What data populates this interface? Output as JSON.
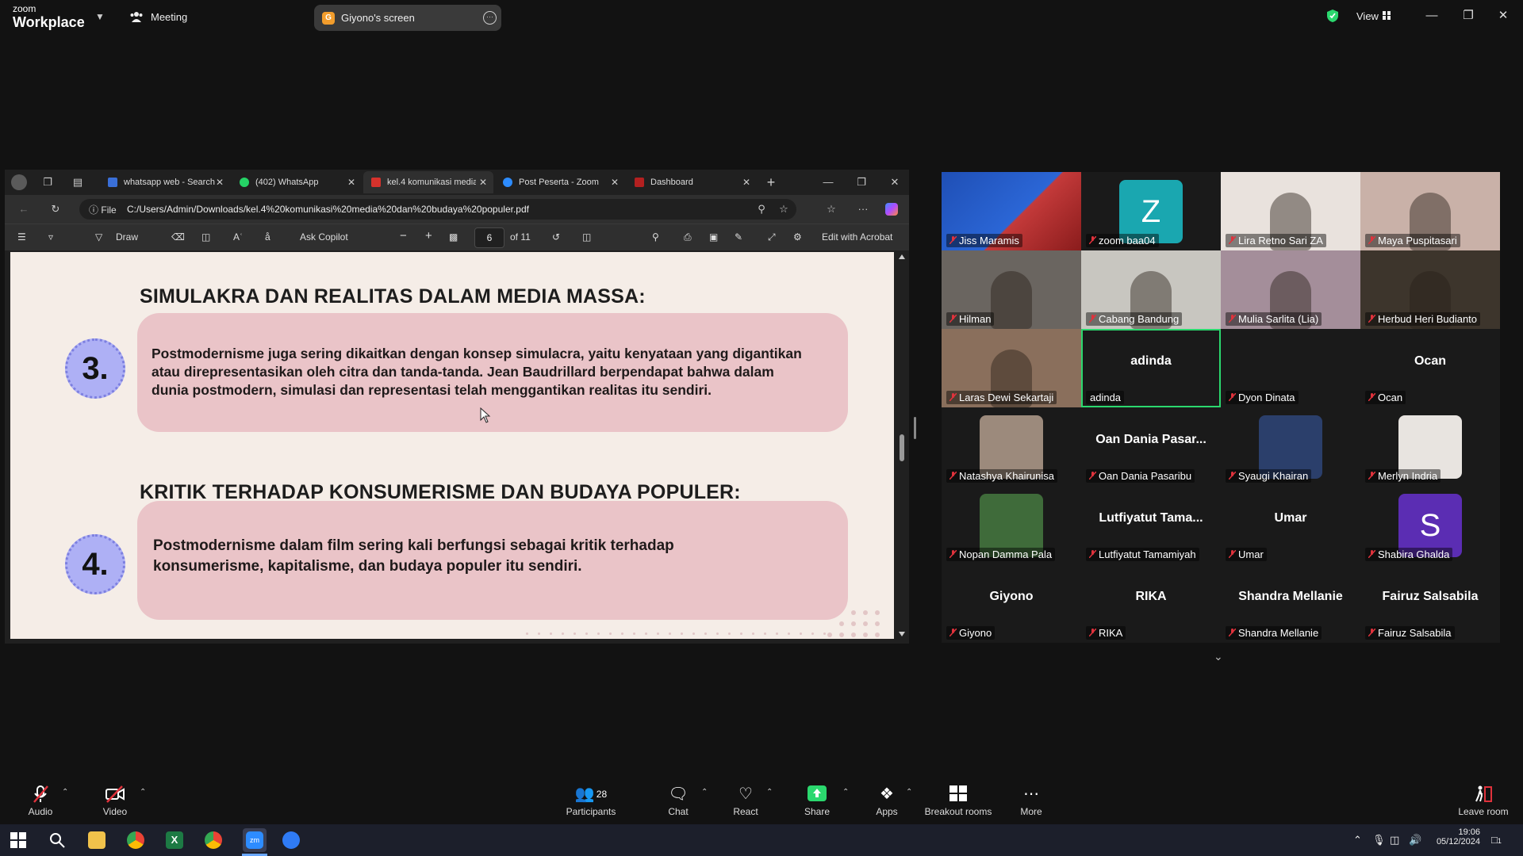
{
  "zoom": {
    "logo_top": "zoom",
    "logo_bottom": "Workplace",
    "meeting_label": "Meeting",
    "share_pill_label": "Giyono's screen",
    "share_pill_initial": "G",
    "view_label": "View"
  },
  "browser": {
    "tabs": [
      {
        "label": "whatsapp web - Search"
      },
      {
        "label": "(402) WhatsApp"
      },
      {
        "label": "kel.4 komunikasi media"
      },
      {
        "label": "Post Peserta - Zoom"
      },
      {
        "label": "Dashboard"
      }
    ],
    "address_prefix": "File",
    "address_url": "C:/Users/Admin/Downloads/kel.4%20komunikasi%20media%20dan%20budaya%20populer.pdf"
  },
  "pdf_toolbar": {
    "draw_label": "Draw",
    "copilot_label": "Ask Copilot",
    "page_current": "6",
    "page_total": "of 11",
    "acrobat_label": "Edit with Acrobat"
  },
  "pdf": {
    "heading_3": "SIMULAKRA DAN REALITAS DALAM MEDIA MASSA:",
    "badge_3": "3.",
    "body_3": [
      "Postmodernisme juga sering dikaitkan dengan konsep simulacra, yaitu kenyataan yang digantikan",
      "atau direpresentasikan oleh citra dan tanda-tanda. Jean Baudrillard berpendapat bahwa dalam",
      "dunia postmodern, simulasi dan representasi telah menggantikan realitas itu sendiri."
    ],
    "heading_4": "KRITIK TERHADAP KONSUMERISME DAN BUDAYA POPULER:",
    "badge_4": "4.",
    "body_4": [
      "Postmodernisme dalam film sering kali berfungsi sebagai kritik terhadap",
      "konsumerisme, kapitalisme, dan budaya populer itu sendiri."
    ]
  },
  "participants": [
    {
      "name": "Jiss  Maramis",
      "muted": true,
      "kind": "slide"
    },
    {
      "name": "zoom baa04",
      "muted": true,
      "kind": "avatar",
      "initial": "Z",
      "color": "#1aa7b0"
    },
    {
      "name": "Lira Retno Sari ZA",
      "muted": true,
      "kind": "photo",
      "color": "#e9e2dd"
    },
    {
      "name": "Maya Puspitasari",
      "muted": true,
      "kind": "photo",
      "color": "#c9b1a8"
    },
    {
      "name": "Hilman",
      "muted": true,
      "kind": "photo",
      "color": "#6a6560"
    },
    {
      "name": "Cabang Bandung",
      "muted": true,
      "kind": "photo",
      "color": "#c8c6c0"
    },
    {
      "name": "Mulia Sarlita (Lia)",
      "muted": true,
      "kind": "photo",
      "color": "#a48e9a"
    },
    {
      "name": "Herbud Heri Budianto",
      "muted": true,
      "kind": "photo",
      "color": "#3d352c"
    },
    {
      "name": "Laras Dewi Sekartaji",
      "muted": true,
      "kind": "photo",
      "color": "#8a6f5c"
    },
    {
      "name": "adinda",
      "muted": false,
      "kind": "name",
      "center": "adinda",
      "active": true
    },
    {
      "name": "Dyon Dinata",
      "muted": true,
      "kind": "name",
      "center": ""
    },
    {
      "name": "Ocan",
      "muted": true,
      "kind": "name",
      "center": "Ocan"
    },
    {
      "name": "Natashya Khairunisa",
      "muted": true,
      "kind": "photo-small",
      "color": "#9c8a7c"
    },
    {
      "name": "Oan Dania Pasaribu",
      "muted": true,
      "kind": "name",
      "center": "Oan  Dania  Pasar..."
    },
    {
      "name": "Syaugi Khairan",
      "muted": true,
      "kind": "photo-small",
      "color": "#2b3f6b"
    },
    {
      "name": "Merlyn Indria",
      "muted": true,
      "kind": "photo-small",
      "color": "#e8e4e0"
    },
    {
      "name": "Nopan Damma Pala",
      "muted": true,
      "kind": "photo-small",
      "color": "#3f6b3a"
    },
    {
      "name": "Lutfiyatut Tamamiyah",
      "muted": true,
      "kind": "name",
      "center": "Lutfiyatut  Tama..."
    },
    {
      "name": "Umar",
      "muted": true,
      "kind": "name",
      "center": "Umar"
    },
    {
      "name": "Shabira Ghalda",
      "muted": true,
      "kind": "avatar",
      "initial": "S",
      "color": "#5b2db3"
    },
    {
      "name": "Giyono",
      "muted": true,
      "kind": "name",
      "center": "Giyono"
    },
    {
      "name": "RIKA",
      "muted": true,
      "kind": "name",
      "center": "RIKA"
    },
    {
      "name": "Shandra Mellanie",
      "muted": true,
      "kind": "name",
      "center": "Shandra Mellanie"
    },
    {
      "name": "Fairuz Salsabila",
      "muted": true,
      "kind": "name",
      "center": "Fairuz Salsabila"
    }
  ],
  "controls": {
    "audio": "Audio",
    "video": "Video",
    "participants": "Participants",
    "participants_count": "28",
    "chat": "Chat",
    "react": "React",
    "share": "Share",
    "apps": "Apps",
    "breakout": "Breakout rooms",
    "more": "More",
    "leave": "Leave room"
  },
  "taskbar": {
    "time": "19:06",
    "date": "05/12/2024",
    "notification_count": "1"
  },
  "colors": {
    "zoom_bg": "#121212",
    "active_speaker": "#2bd86e",
    "share_green": "#2bd86e",
    "mute_red": "#e0323c",
    "pdf_card": "#eac4c8",
    "pdf_badge": "#aeb0f5"
  }
}
